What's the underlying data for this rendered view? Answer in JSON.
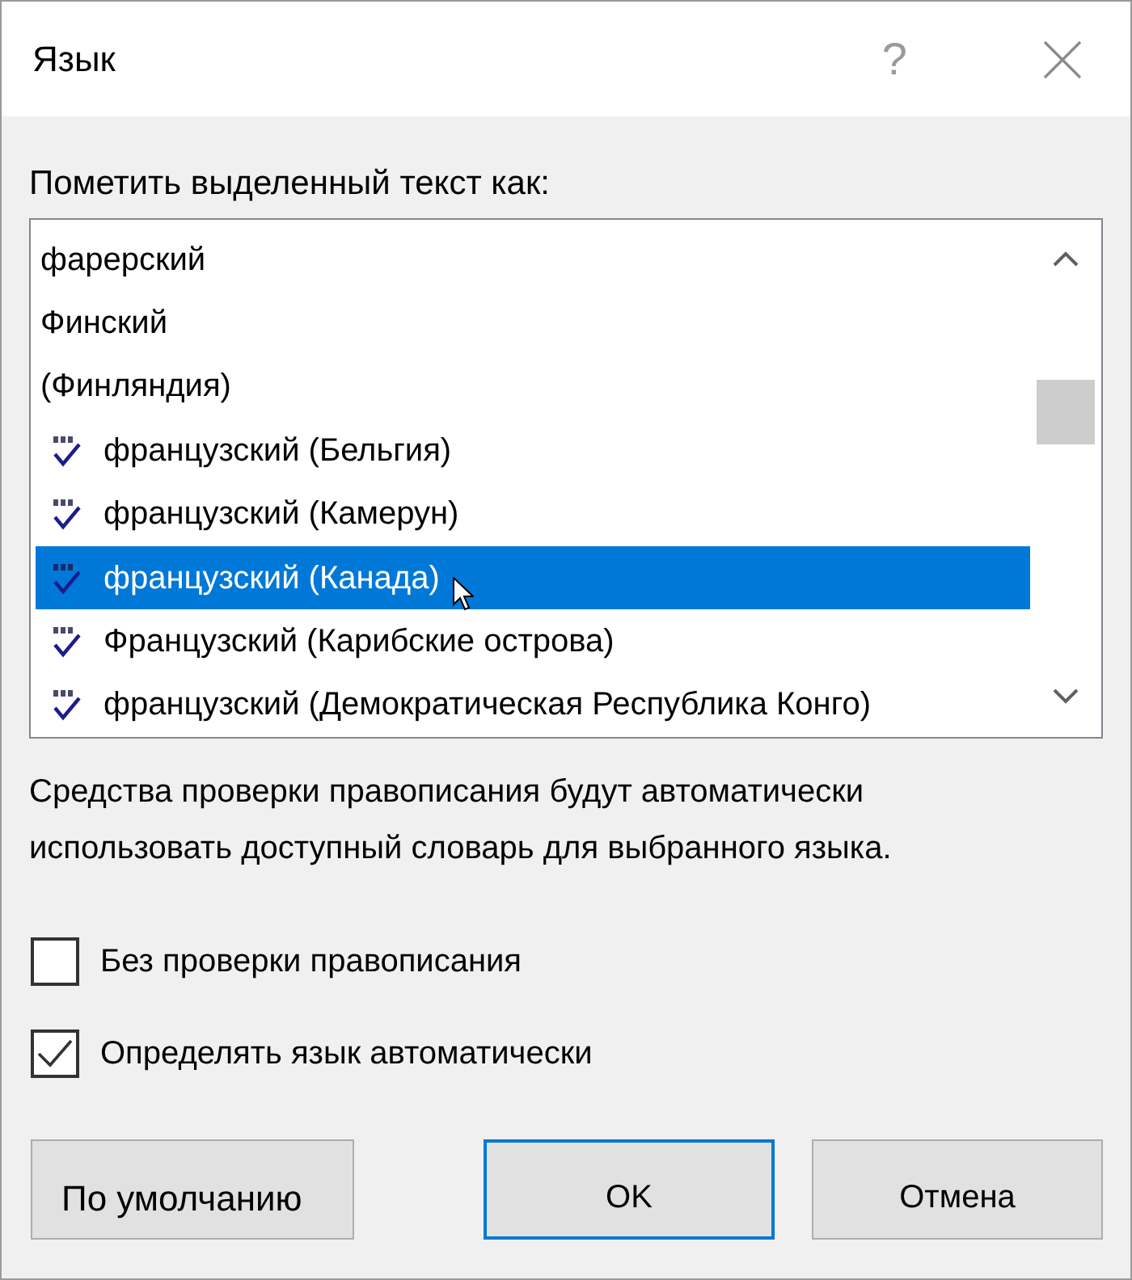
{
  "window": {
    "title": "Язык",
    "help": "?"
  },
  "list_label": "Пометить выделенный текст как:",
  "languages": [
    {
      "label": "фарерский",
      "kind": "plain",
      "selected": false
    },
    {
      "label": "Финский",
      "kind": "plain",
      "selected": false
    },
    {
      "label": "(Финляндия)",
      "kind": "plain",
      "selected": false
    },
    {
      "label": "французский (Бельгия)",
      "kind": "spellcheck",
      "selected": false
    },
    {
      "label": "французский (Камерун)",
      "kind": "spellcheck",
      "selected": false
    },
    {
      "label": "французский (Канада)",
      "kind": "spellcheck",
      "selected": true
    },
    {
      "label": "Французский (Карибские острова)",
      "kind": "spellcheck",
      "selected": false
    },
    {
      "label": "французский (Демократическая Республика Конго)",
      "kind": "spellcheck",
      "selected": false
    }
  ],
  "note": "Средства проверки правописания будут автоматически\nиспользовать доступный словарь для выбранного языка.",
  "options": [
    {
      "label": "Без проверки правописания",
      "checked": false
    },
    {
      "label": "Определять язык автоматически",
      "checked": true
    }
  ],
  "buttons": [
    {
      "label": "По умолчанию",
      "default": false
    },
    {
      "label": "OK",
      "default": true
    },
    {
      "label": "Отмена",
      "default": false
    }
  ]
}
